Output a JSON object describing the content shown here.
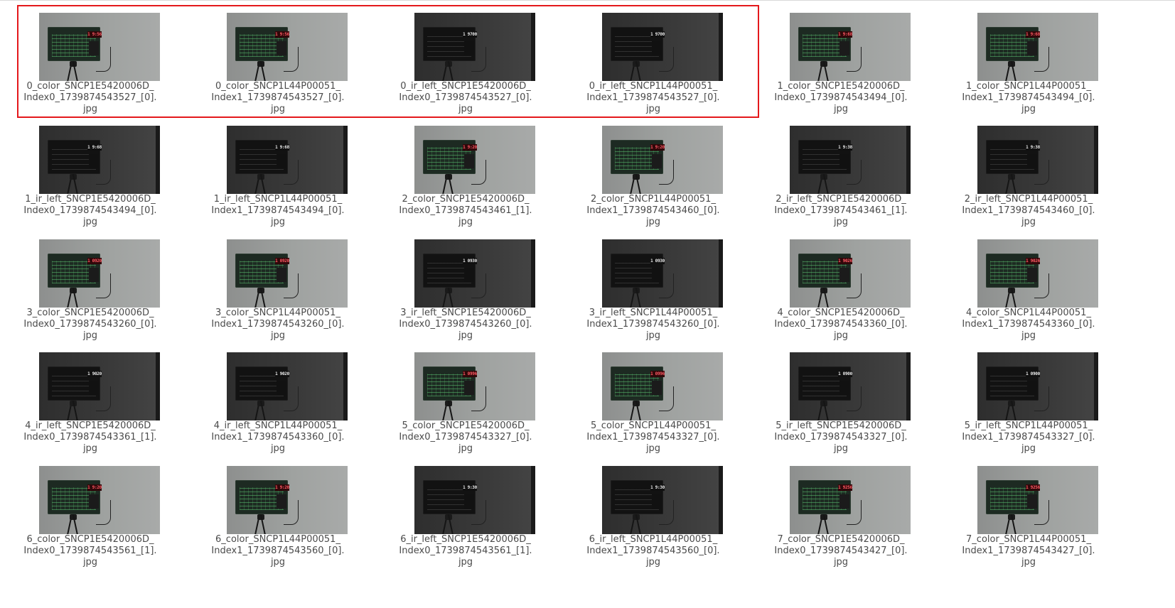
{
  "selection": {
    "color": "#e4181b",
    "selected_count": 4
  },
  "files": [
    {
      "label": "0_color_SNCP1E5420006D_\nIndex0_1739874543527_[0].\njpg",
      "kind": "color",
      "display": "1 9:56"
    },
    {
      "label": "0_color_SNCP1L44P00051_\nIndex1_1739874543527_[0].\njpg",
      "kind": "color",
      "display": "1 9:56"
    },
    {
      "label": "0_ir_left_SNCP1E5420006D_\nIndex0_1739874543527_[0].\njpg",
      "kind": "ir",
      "display": "1 9700"
    },
    {
      "label": "0_ir_left_SNCP1L44P00051_\nIndex1_1739874543527_[0].\njpg",
      "kind": "ir",
      "display": "1 9700"
    },
    {
      "label": "1_color_SNCP1E5420006D_\nIndex0_1739874543494_[0].\njpg",
      "kind": "color",
      "display": "1 9:68"
    },
    {
      "label": "1_color_SNCP1L44P00051_\nIndex1_1739874543494_[0].\njpg",
      "kind": "color",
      "display": "1 9:68"
    },
    {
      "label": "1_ir_left_SNCP1E5420006D_\nIndex0_1739874543494_[0].\njpg",
      "kind": "ir",
      "display": "1 9:68"
    },
    {
      "label": "1_ir_left_SNCP1L44P00051_\nIndex1_1739874543494_[0].\njpg",
      "kind": "ir",
      "display": "1 9:68"
    },
    {
      "label": "2_color_SNCP1E5420006D_\nIndex0_1739874543461_[1].\njpg",
      "kind": "color",
      "display": "1 9:20"
    },
    {
      "label": "2_color_SNCP1L44P00051_\nIndex1_1739874543460_[0].\njpg",
      "kind": "color",
      "display": "1 9:20"
    },
    {
      "label": "2_ir_left_SNCP1E5420006D_\nIndex0_1739874543461_[1].\njpg",
      "kind": "ir",
      "display": "1 9:38"
    },
    {
      "label": "2_ir_left_SNCP1L44P00051_\nIndex1_1739874543460_[0].\njpg",
      "kind": "ir",
      "display": "1 9:38"
    },
    {
      "label": "3_color_SNCP1E5420006D_\nIndex0_1739874543260_[0].\njpg",
      "kind": "color",
      "display": "1 0920"
    },
    {
      "label": "3_color_SNCP1L44P00051_\nIndex1_1739874543260_[0].\njpg",
      "kind": "color",
      "display": "1 0920"
    },
    {
      "label": "3_ir_left_SNCP1E5420006D_\nIndex0_1739874543260_[0].\njpg",
      "kind": "ir",
      "display": "1 0930"
    },
    {
      "label": "3_ir_left_SNCP1L44P00051_\nIndex1_1739874543260_[0].\njpg",
      "kind": "ir",
      "display": "1 0930"
    },
    {
      "label": "4_color_SNCP1E5420006D_\nIndex0_1739874543360_[0].\njpg",
      "kind": "color",
      "display": "1 9026"
    },
    {
      "label": "4_color_SNCP1L44P00051_\nIndex1_1739874543360_[0].\njpg",
      "kind": "color",
      "display": "1 9026"
    },
    {
      "label": "4_ir_left_SNCP1E5420006D_\nIndex0_1739874543361_[1].\njpg",
      "kind": "ir",
      "display": "1 9020"
    },
    {
      "label": "4_ir_left_SNCP1L44P00051_\nIndex1_1739874543360_[0].\njpg",
      "kind": "ir",
      "display": "1 9020"
    },
    {
      "label": "5_color_SNCP1E5420006D_\nIndex0_1739874543327_[0].\njpg",
      "kind": "color",
      "display": "1 0996"
    },
    {
      "label": "5_color_SNCP1L44P00051_\nIndex1_1739874543327_[0].\njpg",
      "kind": "color",
      "display": "1 0996"
    },
    {
      "label": "5_ir_left_SNCP1E5420006D_\nIndex0_1739874543327_[0].\njpg",
      "kind": "ir",
      "display": "1 0900"
    },
    {
      "label": "5_ir_left_SNCP1L44P00051_\nIndex1_1739874543327_[0].\njpg",
      "kind": "ir",
      "display": "1 0900"
    },
    {
      "label": "6_color_SNCP1E5420006D_\nIndex0_1739874543561_[1].\njpg",
      "kind": "color",
      "display": "1 9:20"
    },
    {
      "label": "6_color_SNCP1L44P00051_\nIndex1_1739874543560_[0].\njpg",
      "kind": "color",
      "display": "1 9:20"
    },
    {
      "label": "6_ir_left_SNCP1E5420006D_\nIndex0_1739874543561_[1].\njpg",
      "kind": "ir",
      "display": "1 9:30"
    },
    {
      "label": "6_ir_left_SNCP1L44P00051_\nIndex1_1739874543560_[0].\njpg",
      "kind": "ir",
      "display": "1 9:30"
    },
    {
      "label": "7_color_SNCP1E5420006D_\nIndex0_1739874543427_[0].\njpg",
      "kind": "color",
      "display": "1 9256"
    },
    {
      "label": "7_color_SNCP1L44P00051_\nIndex1_1739874543427_[0].\njpg",
      "kind": "color",
      "display": "1 9256"
    }
  ]
}
